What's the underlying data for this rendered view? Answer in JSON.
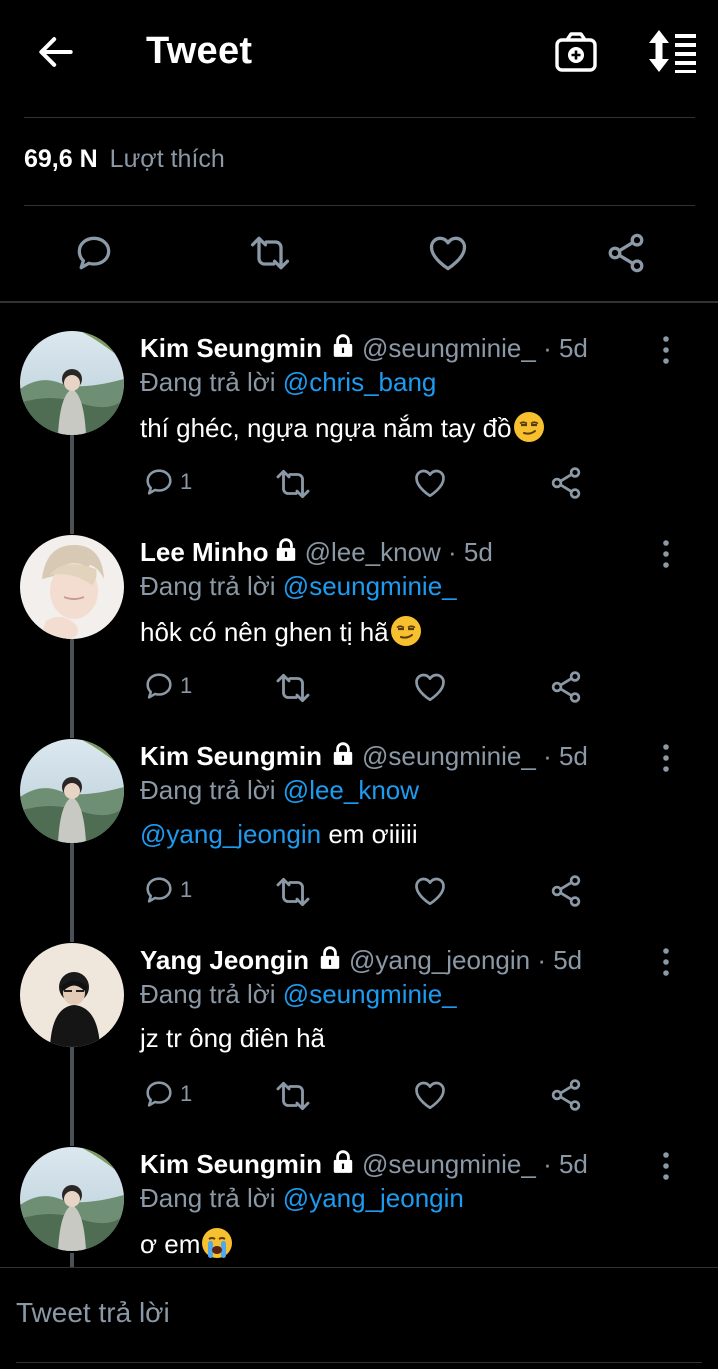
{
  "header": {
    "title": "Tweet",
    "back_icon": "arrow-left-icon",
    "camera_icon": "camera-plus-icon",
    "sort_icon": "sort-list-icon"
  },
  "stats": {
    "likes_count": "69,6 N",
    "likes_label": "Lượt thích"
  },
  "replies": [
    {
      "name": "Kim Seungmin",
      "handle": "@seungminie_ · 5d",
      "replying_prefix": "Đang trả lời",
      "replying_to": "@chris_bang",
      "text": "thí ghéc, ngựa ngựa nắm tay đồ",
      "emoji": "smirk",
      "reply_count": "1"
    },
    {
      "name": "Lee Minho",
      "handle": "@lee_know · 5d",
      "replying_prefix": "Đang trả lời",
      "replying_to": "@seungminie_",
      "text": "hôk có nên ghen tị hã",
      "emoji": "smirk",
      "reply_count": "1"
    },
    {
      "name": "Kim Seungmin",
      "handle": "@seungminie_ · 5d",
      "replying_prefix": "Đang trả lời",
      "replying_to": "@lee_know",
      "text_mention": "@yang_jeongin",
      "text": " em ơiiiii",
      "emoji": "",
      "reply_count": "1"
    },
    {
      "name": "Yang Jeongin",
      "handle": "@yang_jeongin · 5d",
      "replying_prefix": "Đang trả lời",
      "replying_to": "@seungminie_",
      "text": "jz tr ông điên hã",
      "emoji": "",
      "reply_count": "1"
    },
    {
      "name": "Kim Seungmin",
      "handle": "@seungminie_ · 5d",
      "replying_prefix": "Đang trả lời",
      "replying_to": "@yang_jeongin",
      "text": "ơ em",
      "emoji": "crying",
      "reply_count": ""
    }
  ],
  "composer": {
    "placeholder": "Tweet trả lời"
  },
  "colors": {
    "background": "#000000",
    "accent": "#1d9bf0",
    "muted": "#8b98a5",
    "divider": "#2f3336"
  }
}
